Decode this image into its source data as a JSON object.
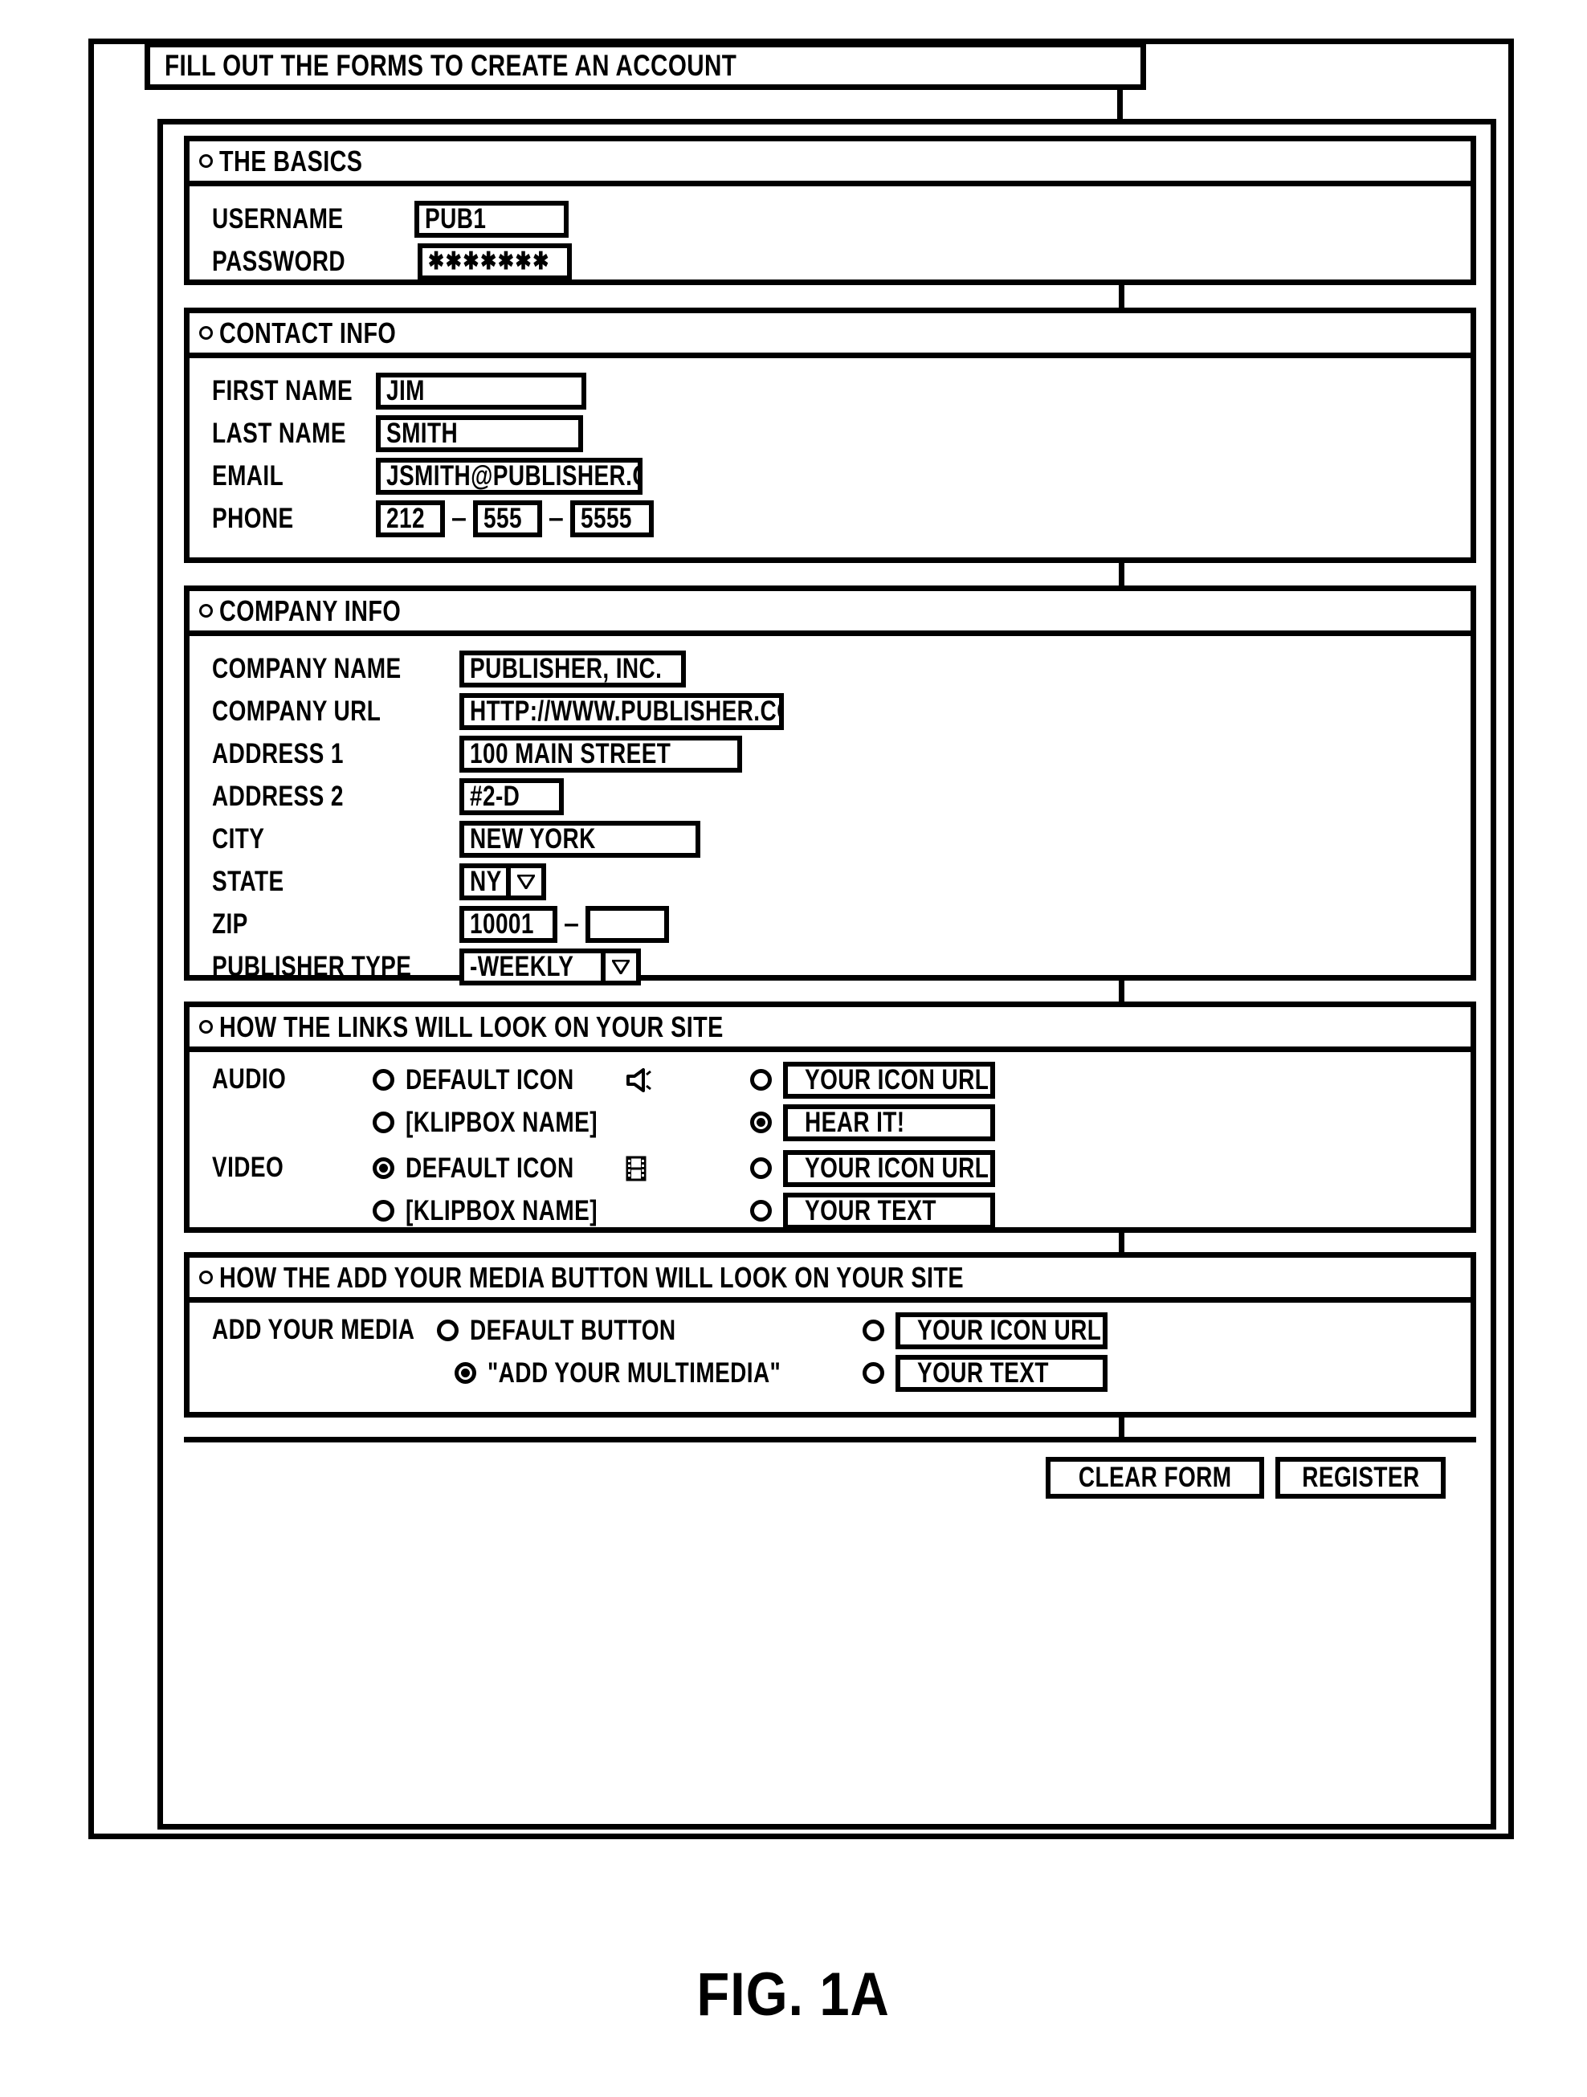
{
  "figure": {
    "caption": "FIG. 1A"
  },
  "window": {
    "title": "FILL OUT THE FORMS TO CREATE AN ACCOUNT"
  },
  "sections": {
    "basics": {
      "header": "THE BASICS",
      "fields": [
        {
          "label": "USERNAME",
          "value": "PUB1"
        },
        {
          "label": "PASSWORD",
          "value": "✱✱✱✱✱✱✱"
        }
      ]
    },
    "contact": {
      "header": "CONTACT INFO",
      "fields": [
        {
          "label": "FIRST NAME",
          "value": "JIM"
        },
        {
          "label": "LAST NAME",
          "value": "SMITH"
        },
        {
          "label": "EMAIL",
          "value": "JSMITH@PUBLISHER.COM"
        }
      ],
      "phone": {
        "label": "PHONE",
        "area_code": "212",
        "prefix": "555",
        "line": "5555",
        "separator": "–"
      }
    },
    "company": {
      "header": "COMPANY INFO",
      "fields": [
        {
          "label": "COMPANY NAME",
          "value": "PUBLISHER, INC."
        },
        {
          "label": "COMPANY URL",
          "value": "HTTP://WWW.PUBLISHER.COM"
        },
        {
          "label": "ADDRESS 1",
          "value": "100 MAIN STREET"
        },
        {
          "label": "ADDRESS 2",
          "value": "#2-D"
        },
        {
          "label": "CITY",
          "value": "NEW YORK"
        }
      ],
      "state": {
        "label": "STATE",
        "value": "NY"
      },
      "zip": {
        "label": "ZIP",
        "value": "10001",
        "plus4": "",
        "separator": "–"
      },
      "publisher_type": {
        "label": "PUBLISHER TYPE",
        "value": "-WEEKLY"
      }
    },
    "links": {
      "header": "HOW THE LINKS WILL LOOK ON YOUR SITE",
      "rows": [
        {
          "label": "AUDIO",
          "left": [
            {
              "text": "DEFAULT ICON",
              "selected": false,
              "icon": "speaker-icon"
            },
            {
              "text": "[KLIPBOX NAME]",
              "selected": false,
              "icon": ""
            }
          ],
          "right": [
            {
              "value": "YOUR ICON URL",
              "selected": false
            },
            {
              "value": "HEAR IT!",
              "selected": true
            }
          ]
        },
        {
          "label": "VIDEO",
          "left": [
            {
              "text": "DEFAULT ICON",
              "selected": true,
              "icon": "filmstrip-icon"
            },
            {
              "text": "[KLIPBOX NAME]",
              "selected": false,
              "icon": ""
            }
          ],
          "right": [
            {
              "value": "YOUR ICON URL",
              "selected": false
            },
            {
              "value": "YOUR TEXT",
              "selected": false
            }
          ]
        }
      ]
    },
    "media_button": {
      "header": "HOW THE ADD YOUR MEDIA BUTTON WILL LOOK ON YOUR SITE",
      "label": "ADD YOUR MEDIA",
      "left": [
        {
          "text": "DEFAULT BUTTON",
          "selected": false
        },
        {
          "text": "\"ADD YOUR MULTIMEDIA\"",
          "selected": true
        }
      ],
      "right": [
        {
          "value": "YOUR ICON URL",
          "selected": false
        },
        {
          "value": "YOUR TEXT",
          "selected": false
        }
      ]
    }
  },
  "footer": {
    "clear_label": "CLEAR FORM",
    "register_label": "REGISTER"
  }
}
